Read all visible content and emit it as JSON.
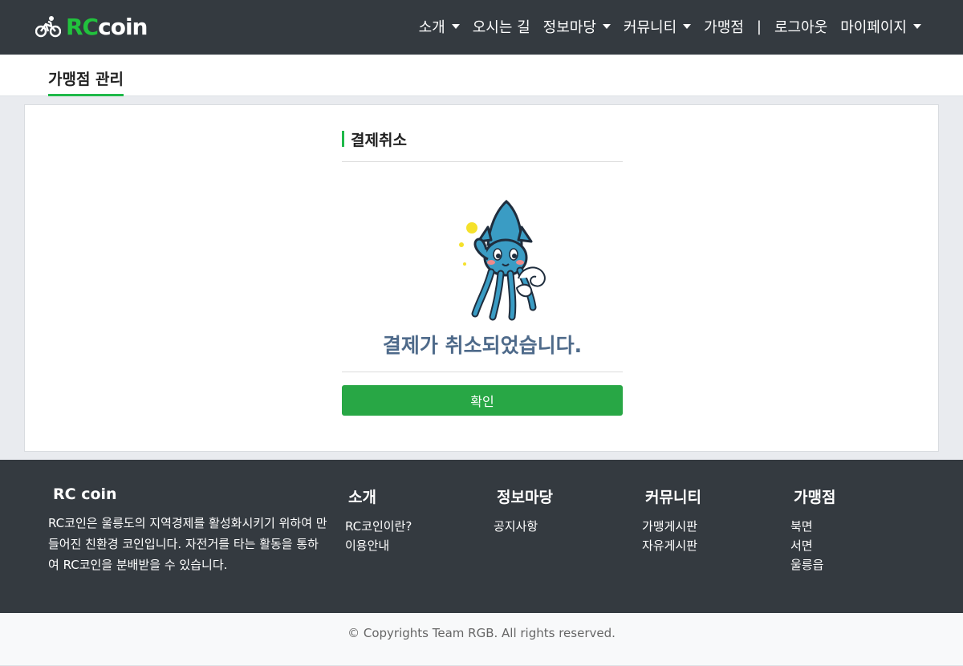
{
  "brand": {
    "rc": "RC",
    "coin": "coin"
  },
  "nav": {
    "items": [
      {
        "label": "소개",
        "dropdown": true
      },
      {
        "label": "오시는 길",
        "dropdown": false
      },
      {
        "label": "정보마당",
        "dropdown": true
      },
      {
        "label": "커뮤니티",
        "dropdown": true
      },
      {
        "label": "가맹점",
        "dropdown": false
      }
    ],
    "separator": "|",
    "logout": "로그아웃",
    "mypage": "마이페이지"
  },
  "subheader": {
    "tab": "가맹점 관리"
  },
  "card": {
    "title": "결제취소",
    "message": "결제가 취소되었습니다.",
    "confirm_button": "확인"
  },
  "footer": {
    "about": {
      "title": "RC coin",
      "description": "RC코인은 울릉도의 지역경제를 활성화시키기 위하여 만들어진 친환경 코인입니다. 자전거를 타는 활동을 통하여 RC코인을 분배받을 수 있습니다."
    },
    "columns": [
      {
        "title": "소개",
        "links": [
          "RC코인이란?",
          "이용안내"
        ]
      },
      {
        "title": "정보마당",
        "links": [
          "공지사항"
        ]
      },
      {
        "title": "커뮤니티",
        "links": [
          "가맹게시판",
          "자유게시판"
        ]
      },
      {
        "title": "가맹점",
        "links": [
          "북면",
          "서면",
          "울릉읍"
        ]
      }
    ]
  },
  "copyright": "© Copyrights Team RGB. All rights reserved.",
  "colors": {
    "navbar": "#343a40",
    "brand_green": "#21c23d",
    "accent_green": "#28a745",
    "message_text": "#4e6a8a"
  },
  "icons": {
    "brand": "bicycle-icon",
    "mascot": "squid-mascot"
  }
}
